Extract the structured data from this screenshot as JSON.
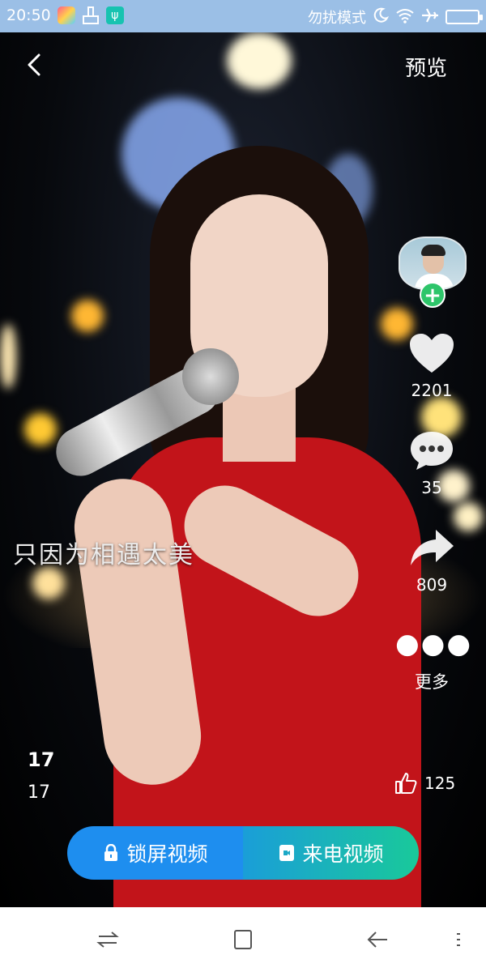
{
  "status_bar": {
    "time": "20:50",
    "dnd_label": "勿扰模式",
    "icons": [
      "app-icon",
      "clean-icon",
      "usb-icon",
      "moon-icon",
      "wifi-icon",
      "airplane-icon",
      "battery-icon"
    ]
  },
  "top_bar": {
    "back_icon": "chevron-left-icon",
    "preview_label": "预览"
  },
  "video": {
    "lyric": "只因为相遇太美"
  },
  "actions": {
    "like_count": "2201",
    "comment_count": "35",
    "share_count": "809",
    "more_label": "更多"
  },
  "info": {
    "title": "17",
    "subtitle": "17",
    "thumbs_count": "125"
  },
  "buttons": {
    "lock_screen_label": "锁屏视频",
    "call_video_label": "来电视频"
  },
  "nav_bar": {
    "icons": [
      "switch-icon",
      "home-square-icon",
      "back-arrow-icon",
      "menu-icon"
    ]
  },
  "colors": {
    "status_bar": "#9bbfe6",
    "lock_button": "#1e8eef",
    "call_button_start": "#1a9ed8",
    "call_button_end": "#19c99a",
    "follow_plus": "#2ec56a",
    "dress": "#c2141a"
  }
}
